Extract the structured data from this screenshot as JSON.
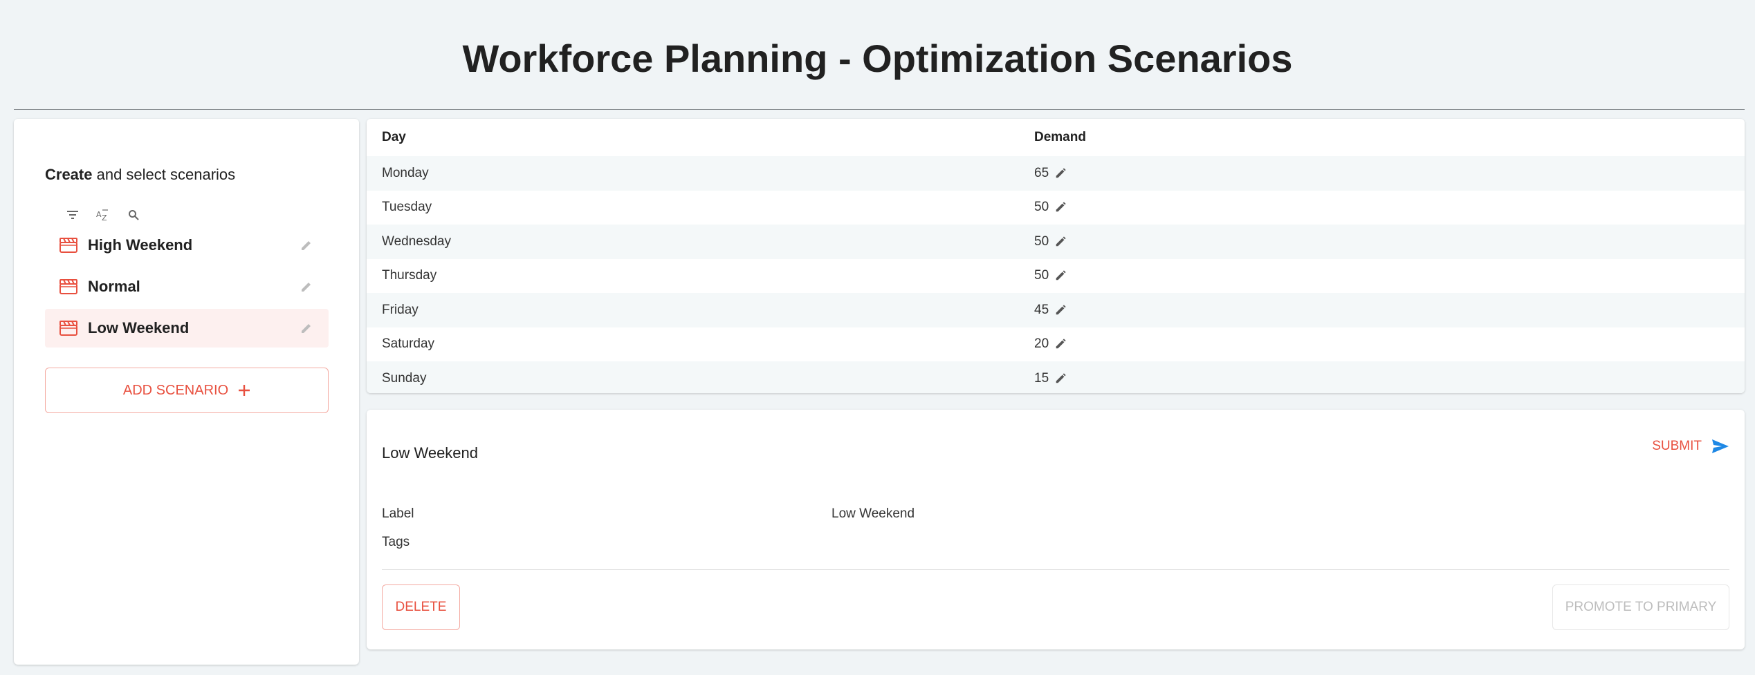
{
  "page": {
    "title": "Workforce Planning - Optimization Scenarios"
  },
  "sidebar": {
    "heading_bold": "Create",
    "heading_rest": " and select scenarios",
    "toolbar": [
      "filter-icon",
      "sort-az-icon",
      "search-icon"
    ],
    "scenarios": [
      {
        "name": "High Weekend",
        "selected": false
      },
      {
        "name": "Normal",
        "selected": false
      },
      {
        "name": "Low Weekend",
        "selected": true
      }
    ],
    "add_label": "ADD SCENARIO"
  },
  "table": {
    "headers": {
      "day": "Day",
      "demand": "Demand"
    },
    "rows": [
      {
        "day": "Monday",
        "demand": "65"
      },
      {
        "day": "Tuesday",
        "demand": "50"
      },
      {
        "day": "Wednesday",
        "demand": "50"
      },
      {
        "day": "Thursday",
        "demand": "50"
      },
      {
        "day": "Friday",
        "demand": "45"
      },
      {
        "day": "Saturday",
        "demand": "20"
      },
      {
        "day": "Sunday",
        "demand": "15"
      }
    ]
  },
  "detail": {
    "title": "Low Weekend",
    "submit_label": "SUBMIT",
    "label_field": "Label",
    "label_value": "Low Weekend",
    "tags_field": "Tags",
    "delete_label": "DELETE",
    "promote_label": "PROMOTE TO PRIMARY"
  },
  "colors": {
    "accent": "#e8503f",
    "send": "#1e88e5",
    "background": "#f0f4f6"
  }
}
